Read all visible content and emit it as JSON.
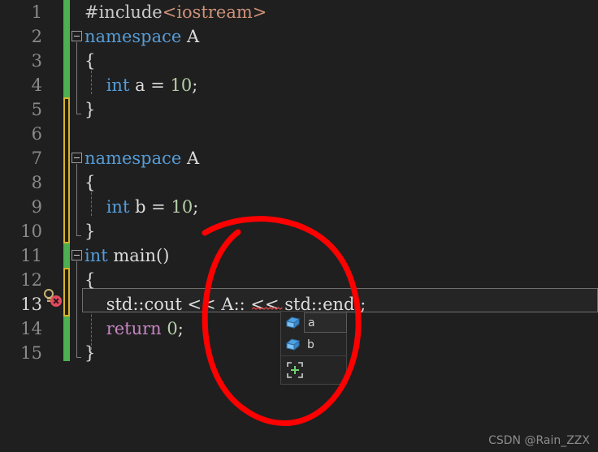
{
  "editor": {
    "theme_background": "#1f1f1f",
    "line_height": 30,
    "first_line_top": 0,
    "line_numbers": [
      "1",
      "2",
      "3",
      "4",
      "5",
      "6",
      "7",
      "8",
      "9",
      "10",
      "11",
      "12",
      "13",
      "14",
      "15"
    ],
    "current_line": 13,
    "lines": [
      {
        "num": "1",
        "indent": 0,
        "tokens": [
          {
            "t": "#include",
            "c": "pp"
          },
          {
            "t": "<iostream>",
            "c": "str"
          }
        ]
      },
      {
        "num": "2",
        "indent": 0,
        "tokens": [
          {
            "t": "namespace",
            "c": "kw"
          },
          {
            "t": " ",
            "c": "plain"
          },
          {
            "t": "A",
            "c": "ident"
          }
        ]
      },
      {
        "num": "3",
        "indent": 0,
        "tokens": [
          {
            "t": "{",
            "c": "plain"
          }
        ]
      },
      {
        "num": "4",
        "indent": 0,
        "tokens": [
          {
            "t": "    ",
            "c": "plain"
          },
          {
            "t": "int",
            "c": "kw"
          },
          {
            "t": " a = ",
            "c": "plain"
          },
          {
            "t": "10",
            "c": "num"
          },
          {
            "t": ";",
            "c": "plain"
          }
        ]
      },
      {
        "num": "5",
        "indent": 0,
        "tokens": [
          {
            "t": "}",
            "c": "plain"
          }
        ]
      },
      {
        "num": "6",
        "indent": 0,
        "tokens": []
      },
      {
        "num": "7",
        "indent": 0,
        "tokens": [
          {
            "t": "namespace",
            "c": "kw"
          },
          {
            "t": " ",
            "c": "plain"
          },
          {
            "t": "A",
            "c": "ident"
          }
        ]
      },
      {
        "num": "8",
        "indent": 0,
        "tokens": [
          {
            "t": "{",
            "c": "plain"
          }
        ]
      },
      {
        "num": "9",
        "indent": 0,
        "tokens": [
          {
            "t": "    ",
            "c": "plain"
          },
          {
            "t": "int",
            "c": "kw"
          },
          {
            "t": " b = ",
            "c": "plain"
          },
          {
            "t": "10",
            "c": "num"
          },
          {
            "t": ";",
            "c": "plain"
          }
        ]
      },
      {
        "num": "10",
        "indent": 0,
        "tokens": [
          {
            "t": "}",
            "c": "plain"
          }
        ]
      },
      {
        "num": "11",
        "indent": 0,
        "tokens": [
          {
            "t": "int",
            "c": "kw"
          },
          {
            "t": " ",
            "c": "plain"
          },
          {
            "t": "main",
            "c": "fn"
          },
          {
            "t": "()",
            "c": "plain"
          }
        ]
      },
      {
        "num": "12",
        "indent": 0,
        "tokens": [
          {
            "t": "{",
            "c": "plain"
          }
        ]
      },
      {
        "num": "13",
        "indent": 0,
        "tokens": [
          {
            "t": "    std::cout << A:: << std::endl;",
            "c": "plain"
          }
        ]
      },
      {
        "num": "14",
        "indent": 0,
        "tokens": [
          {
            "t": "    ",
            "c": "plain"
          },
          {
            "t": "return",
            "c": "ctrl"
          },
          {
            "t": " ",
            "c": "plain"
          },
          {
            "t": "0",
            "c": "num"
          },
          {
            "t": ";",
            "c": "plain"
          }
        ]
      },
      {
        "num": "15",
        "indent": 0,
        "tokens": [
          {
            "t": "}",
            "c": "plain"
          }
        ]
      }
    ],
    "line_text": {
      "l1": "#include<iostream>",
      "l2": "namespace A",
      "l3": "{",
      "l4": "    int a = 10;",
      "l5": "}",
      "l6": "",
      "l7": "namespace A",
      "l8": "{",
      "l9": "    int b = 10;",
      "l10": "}",
      "l11": "int main()",
      "l12": "{",
      "l13": "    std::cout << A:: << std::endl;",
      "l14": "    return 0;",
      "l15": "}"
    },
    "error": {
      "line": "13",
      "underlined_text": "A::",
      "marker_icon": "lightbulb-error-icon",
      "marker_color": "#c9b271",
      "badge_color": "#e04a5f"
    },
    "change_bar": {
      "saved_color": "#4caf50",
      "unsaved_color": "#d8b428",
      "segments": [
        {
          "state": "saved",
          "from_line": 1,
          "to_line": 4
        },
        {
          "state": "unsaved",
          "from_line": 5,
          "to_line": 10
        },
        {
          "state": "saved",
          "from_line": 11,
          "to_line": 11
        },
        {
          "state": "unsaved",
          "from_line": 12,
          "to_line": 13
        },
        {
          "state": "saved",
          "from_line": 14,
          "to_line": 15
        }
      ]
    },
    "fold_markers": [
      {
        "line": 2,
        "state": "expanded",
        "glyph": "minus"
      },
      {
        "line": 7,
        "state": "expanded",
        "glyph": "minus"
      },
      {
        "line": 11,
        "state": "expanded",
        "glyph": "minus"
      }
    ],
    "syntax_colors": {
      "keyword": "#569cd6",
      "control": "#c586c0",
      "number": "#b5cea8",
      "string": "#ce9178",
      "function": "#dcdcaa",
      "plain": "#dcdcdc",
      "preprocessor": "#c8c8c8",
      "line_number": "#8a8a8a",
      "line_number_active": "#d8d8d8"
    }
  },
  "autocomplete": {
    "visible": true,
    "items": [
      {
        "label": "a",
        "icon": "variable-box-icon",
        "selected": true
      },
      {
        "label": "b",
        "icon": "variable-box-icon",
        "selected": false
      }
    ],
    "footer_icon": "expand-crosshair-icon",
    "icon_color": "#4ea0e0",
    "footer_icon_color": "#6fcf6f",
    "background": "#252526",
    "border": "#454545"
  },
  "annotation": {
    "type": "hand-drawn-ellipse",
    "color": "#ff0000",
    "stroke_width": 7
  },
  "watermark": {
    "text": "CSDN @Rain_ZZX",
    "color": "#8c8c8c"
  }
}
